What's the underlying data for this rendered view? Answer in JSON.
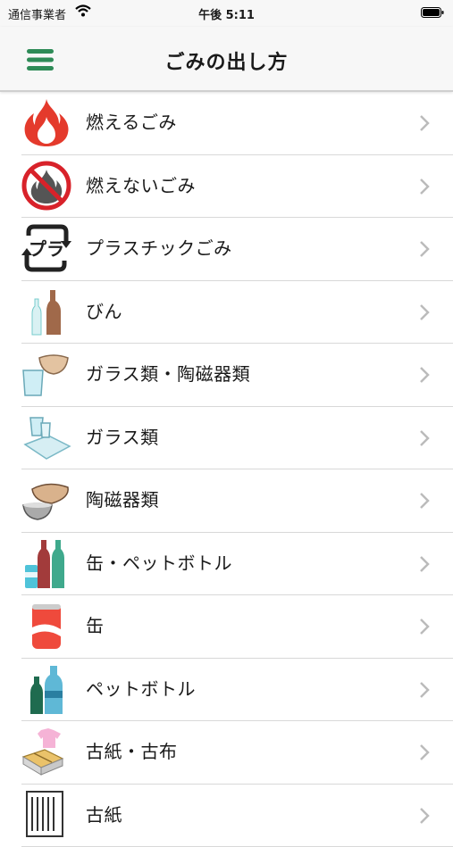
{
  "status": {
    "carrier": "通信事業者",
    "time": "午後 5:11"
  },
  "nav": {
    "title": "ごみの出し方",
    "menu_icon": "hamburger-menu-icon",
    "accent": "#2e8b57"
  },
  "items": [
    {
      "label": "燃えるごみ",
      "icon": "fire-icon"
    },
    {
      "label": "燃えないごみ",
      "icon": "no-fire-icon"
    },
    {
      "label": "プラスチックごみ",
      "icon": "plastic-recycle-icon"
    },
    {
      "label": "びん",
      "icon": "bottles-icon"
    },
    {
      "label": "ガラス類・陶磁器類",
      "icon": "glass-ceramic-icon"
    },
    {
      "label": "ガラス類",
      "icon": "glass-icon"
    },
    {
      "label": "陶磁器類",
      "icon": "ceramic-bowl-icon"
    },
    {
      "label": "缶・ペットボトル",
      "icon": "can-pet-bottle-icon"
    },
    {
      "label": "缶",
      "icon": "can-icon"
    },
    {
      "label": "ペットボトル",
      "icon": "pet-bottle-icon"
    },
    {
      "label": "古紙・古布",
      "icon": "paper-cloth-icon"
    },
    {
      "label": "古紙",
      "icon": "paper-icon"
    }
  ]
}
